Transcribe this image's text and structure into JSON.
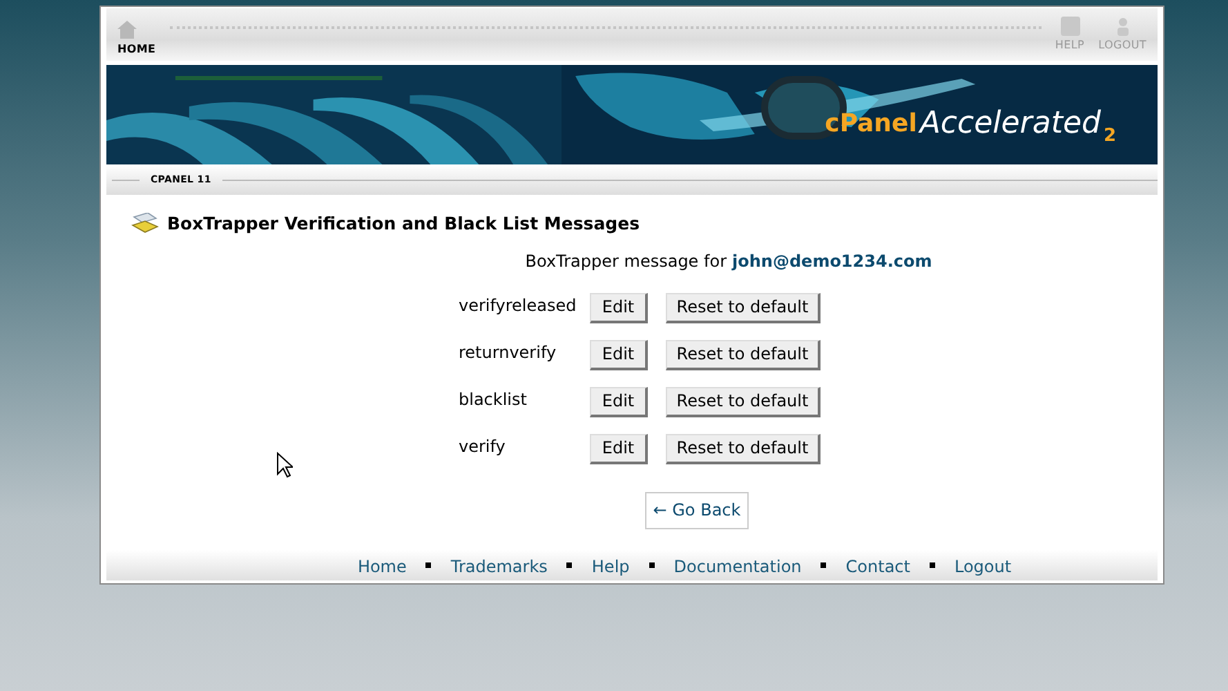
{
  "top_nav": [
    {
      "kind": "home",
      "label": "HOME"
    },
    {
      "kind": "help",
      "label": "HELP"
    },
    {
      "kind": "logout",
      "label": "LOGOUT"
    }
  ],
  "banner": {
    "logo": "cPanel",
    "product": "Accelerated",
    "version": "2"
  },
  "breadcrumb": "CPANEL 11",
  "title": "BoxTrapper Verification and Black List Messages",
  "intro": {
    "text": "BoxTrapper message for",
    "email": "john@demo1234.com"
  },
  "messages": [
    {
      "name": "verifyreleased",
      "edit": "Edit",
      "reset": "Reset to default"
    },
    {
      "name": "returnverify",
      "edit": "Edit",
      "reset": "Reset to default"
    },
    {
      "name": "blacklist",
      "edit": "Edit",
      "reset": "Reset to default"
    },
    {
      "name": "verify",
      "edit": "Edit",
      "reset": "Reset to default"
    }
  ],
  "go_back": "← Go Back",
  "footer_links": [
    "Home",
    "Trademarks",
    "Help",
    "Documentation",
    "Contact",
    "Logout"
  ]
}
